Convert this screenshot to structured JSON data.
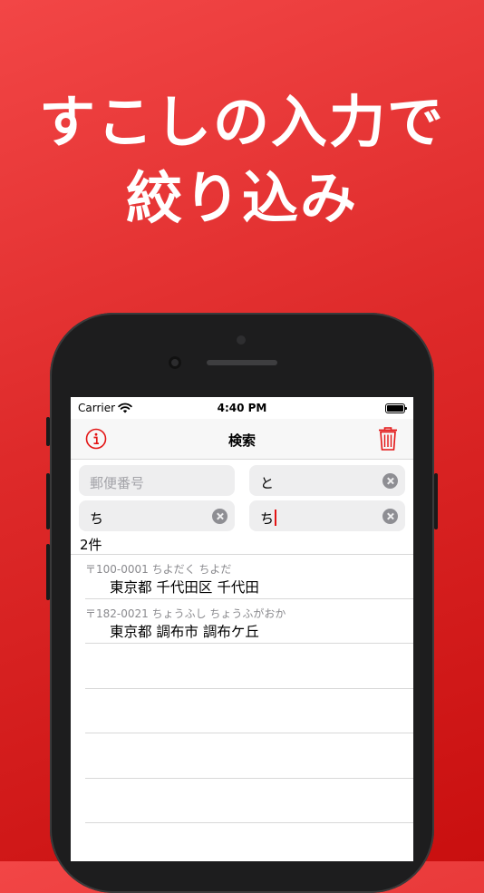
{
  "headline": {
    "line1": "すこしの入力で",
    "line2": "絞り込み"
  },
  "status_bar": {
    "carrier": "Carrier",
    "time": "4:40 PM"
  },
  "nav": {
    "title": "検索",
    "left_icon": "info-icon",
    "right_icon": "trash-icon"
  },
  "search": {
    "postal_code": {
      "placeholder": "郵便番号",
      "value": ""
    },
    "field2": {
      "value": "と"
    },
    "field3": {
      "value": "ち"
    },
    "field4": {
      "value": "ち"
    }
  },
  "results": {
    "count": "2件",
    "items": [
      {
        "sub": "〒100-0001 ちよだく ちよだ",
        "main": "東京都 千代田区 千代田"
      },
      {
        "sub": "〒182-0021 ちょうふし ちょうふがおか",
        "main": "東京都 調布市 調布ケ丘"
      }
    ]
  },
  "colors": {
    "accent": "#e31414",
    "background_top": "#f24646",
    "background_bottom": "#c90f0f"
  }
}
